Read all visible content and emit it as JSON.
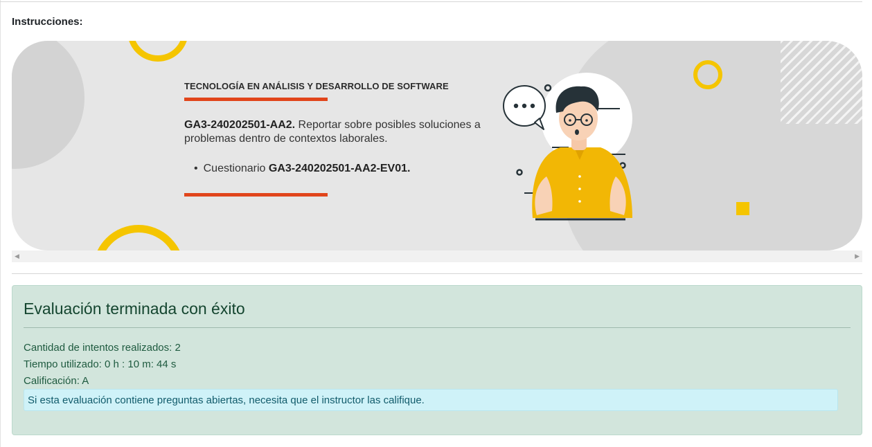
{
  "page": {
    "instructions_label": "Instrucciones:"
  },
  "banner": {
    "program_title": "TECNOLOGÍA EN ANÁLISIS Y DESARROLLO DE SOFTWARE",
    "activity_code": "GA3-240202501-AA2.",
    "activity_text": " Reportar sobre posibles soluciones a problemas dentro de contextos laborales.",
    "list_prefix": "Cuestionario ",
    "list_code": "GA3-240202501-AA2-EV01.",
    "illustration": "thinking-man-speech-bubble-illustration",
    "accent_color": "#e1451b",
    "decor_color": "#f5c500"
  },
  "result": {
    "title": "Evaluación terminada con éxito",
    "attempts": "Cantidad de intentos realizados: 2",
    "time_used": "Tiempo utilizado: 0 h : 10 m: 44 s",
    "grade": "Calificación: A",
    "notice": "Si esta evaluación contiene preguntas abiertas, necesita que el instructor las califique.",
    "bg_color": "#d2e5dc",
    "notice_bg_color": "#cff2f8"
  },
  "scrollbar": {
    "left_arrow_icon": "triangle-left-icon",
    "right_arrow_icon": "triangle-right-icon"
  }
}
